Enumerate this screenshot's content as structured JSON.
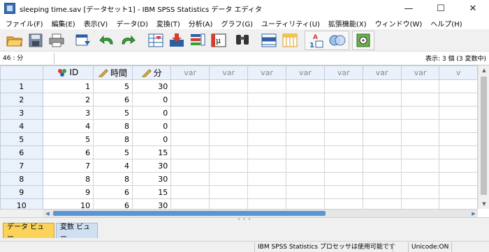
{
  "window": {
    "title": "sleeping time.sav [データセット1] - IBM SPSS Statistics データ エディタ",
    "minimize": "—",
    "maximize": "☐",
    "close": "✕"
  },
  "menu": [
    "ファイル(F)",
    "編集(E)",
    "表示(V)",
    "データ(D)",
    "変換(T)",
    "分析(A)",
    "グラフ(G)",
    "ユーティリティ(U)",
    "拡張機能(X)",
    "ウィンドウ(W)",
    "ヘルプ(H)"
  ],
  "toolbar": {
    "icons": [
      "open-folder-icon",
      "save-icon",
      "print-icon",
      "recall-dialog-icon",
      "undo-icon",
      "redo-icon",
      "goto-case-icon",
      "goto-variable-icon",
      "variables-icon",
      "run-descriptive-icon",
      "find-icon",
      "insert-cases-icon",
      "insert-variable-icon",
      "split-file-icon",
      "weight-cases-icon",
      "select-cases-icon",
      "value-labels-icon",
      "use-variable-sets-icon",
      "spell-check-icon"
    ]
  },
  "refbar": {
    "cell_ref": "46 : 分",
    "cell_value": "",
    "status": "表示: 3 個 (3 変数中)"
  },
  "grid": {
    "columns": [
      {
        "label": "ID",
        "icon": "nominal-measure-icon",
        "type": "var"
      },
      {
        "label": "時間",
        "icon": "scale-measure-icon",
        "type": "var"
      },
      {
        "label": "分",
        "icon": "scale-measure-icon",
        "type": "var"
      },
      {
        "label": "var",
        "type": "empty"
      },
      {
        "label": "var",
        "type": "empty"
      },
      {
        "label": "var",
        "type": "empty"
      },
      {
        "label": "var",
        "type": "empty"
      },
      {
        "label": "var",
        "type": "empty"
      },
      {
        "label": "var",
        "type": "empty"
      },
      {
        "label": "var",
        "type": "empty"
      },
      {
        "label": "v",
        "type": "empty"
      }
    ],
    "rows": [
      {
        "num": "1",
        "cells": [
          "1",
          "5",
          "30"
        ]
      },
      {
        "num": "2",
        "cells": [
          "2",
          "6",
          "0"
        ]
      },
      {
        "num": "3",
        "cells": [
          "3",
          "5",
          "0"
        ]
      },
      {
        "num": "4",
        "cells": [
          "4",
          "8",
          "0"
        ]
      },
      {
        "num": "5",
        "cells": [
          "5",
          "8",
          "0"
        ]
      },
      {
        "num": "6",
        "cells": [
          "6",
          "5",
          "15"
        ]
      },
      {
        "num": "7",
        "cells": [
          "7",
          "4",
          "30"
        ]
      },
      {
        "num": "8",
        "cells": [
          "8",
          "8",
          "30"
        ]
      },
      {
        "num": "9",
        "cells": [
          "9",
          "6",
          "15"
        ]
      },
      {
        "num": "10",
        "cells": [
          "10",
          "6",
          "30"
        ]
      }
    ]
  },
  "tabs": {
    "data_view": "データ ビュー",
    "variable_view": "変数 ビュー"
  },
  "statusbar": {
    "processor": "IBM SPSS Statistics プロセッサは使用可能です",
    "unicode": "Unicode:ON"
  },
  "colors": {
    "header_bg": "#eaf1fa",
    "data_tab": "#fbd35a",
    "var_tab": "#cfe0f2",
    "scroll_thumb": "#5a95d8"
  }
}
